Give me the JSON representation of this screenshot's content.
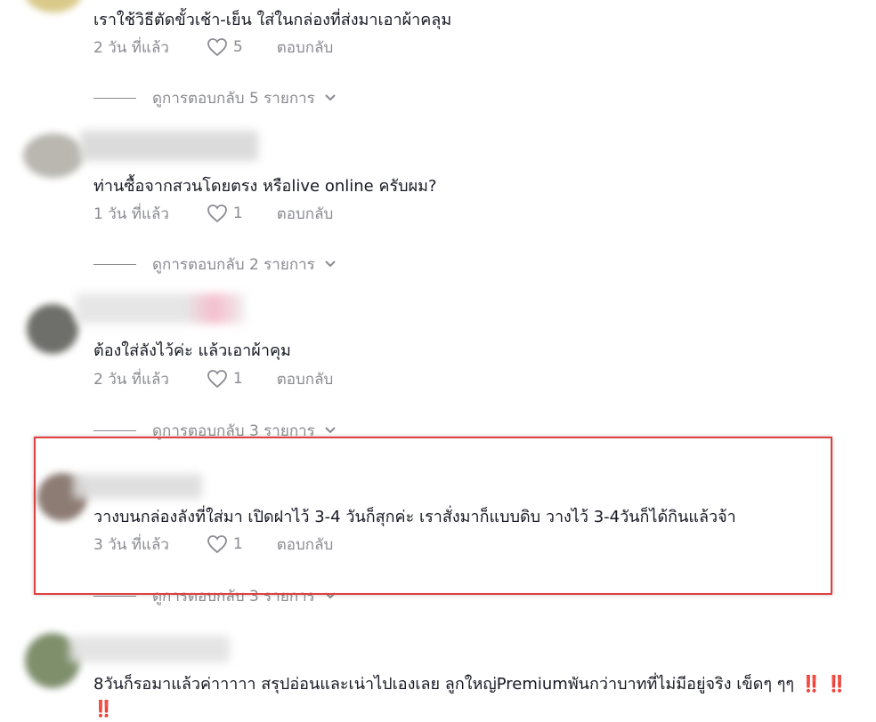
{
  "colors": {
    "highlight": "#e04040",
    "muted": "#8a8b91",
    "text": "#161823"
  },
  "comments": [
    {
      "text": "เราใช้วิธีตัดขั้วเช้า-เย็น ใส่ในกล่องที่ส่งมาเอาผ้าคลุม",
      "time": "2 วัน ที่แล้ว",
      "likes": "5",
      "reply": "ตอบกลับ",
      "view_replies": "ดูการตอบกลับ 5 รายการ"
    },
    {
      "text": "ท่านซื้อจากสวนโดยตรง หรือlive online ครับผม?",
      "time": "1 วัน ที่แล้ว",
      "likes": "1",
      "reply": "ตอบกลับ",
      "view_replies": "ดูการตอบกลับ 2 รายการ"
    },
    {
      "text": "ต้องใส่ลังไว้ค่ะ แล้วเอาผ้าคุม",
      "time": "2 วัน ที่แล้ว",
      "likes": "1",
      "reply": "ตอบกลับ",
      "view_replies": "ดูการตอบกลับ 3 รายการ"
    },
    {
      "text": "วางบนกล่องลังที่ใส่มา เปิดฝาไว้ 3-4 วันก็สุกค่ะ เราสั่งมาก็แบบดิบ วางไว้ 3-4วันก็ได้กินแล้วจ้า",
      "time": "3 วัน ที่แล้ว",
      "likes": "1",
      "reply": "ตอบกลับ",
      "view_replies": "ดูการตอบกลับ 3 รายการ"
    },
    {
      "text": "8วันก็รอมาแล้วค่าาาาา สรุปอ่อนและเน่าไปเองเลย ลูกใหญ่Premiumพันกว่าบาทที่ไม่มีอยู่จริง เข็ดๆ ๆๆ",
      "emoji": "‼️ ‼️ ‼️"
    }
  ]
}
